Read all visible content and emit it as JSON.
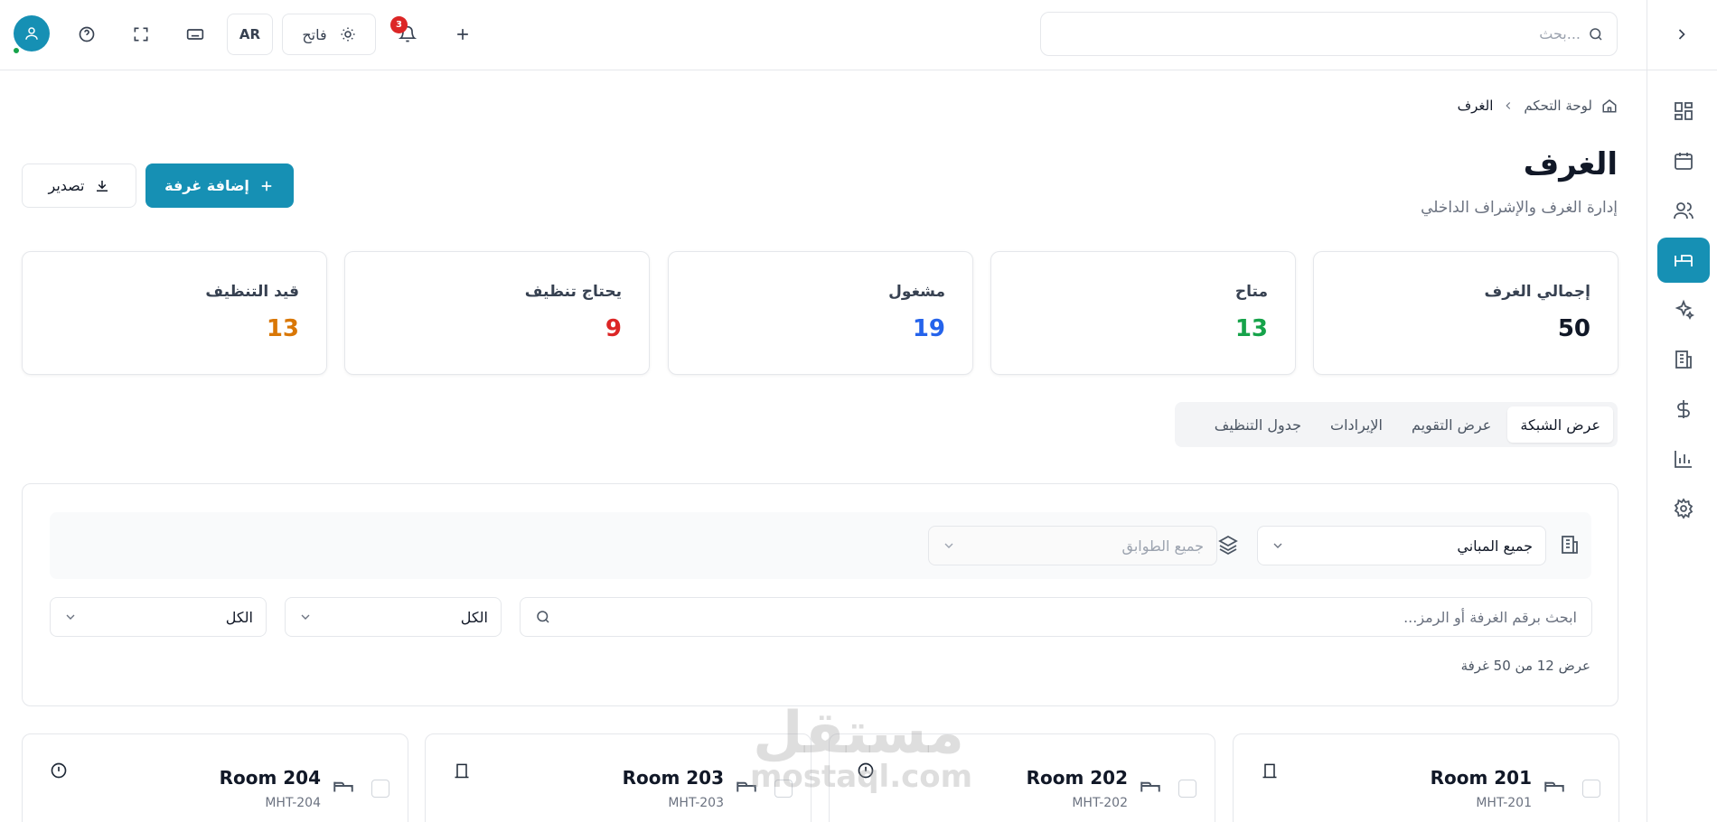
{
  "topbar": {
    "search_placeholder": "بحث...",
    "language": "AR",
    "theme_label": "فاتح",
    "notification_count": "3"
  },
  "breadcrumb": {
    "home": "لوحة التحكم",
    "current": "الغرف"
  },
  "page": {
    "title": "الغرف",
    "subtitle": "إدارة الغرف والإشراف الداخلي",
    "add_button": "إضافة غرفة",
    "export_button": "تصدير"
  },
  "stats": [
    {
      "label": "إجمالي الغرف",
      "value": "50",
      "color": "#111827"
    },
    {
      "label": "متاح",
      "value": "13",
      "color": "#16a34a"
    },
    {
      "label": "مشغول",
      "value": "19",
      "color": "#2563eb"
    },
    {
      "label": "يحتاج تنظيف",
      "value": "9",
      "color": "#dc2626"
    },
    {
      "label": "قيد التنظيف",
      "value": "13",
      "color": "#d97706"
    }
  ],
  "tabs": [
    "عرض الشبكة",
    "عرض التقويم",
    "الإيرادات",
    "جدول التنظيف"
  ],
  "filters": {
    "building": "جميع المباني",
    "floor": "جميع الطوابق",
    "room_search_placeholder": "ابحث برقم الغرفة أو الرمز...",
    "status_select": "الكل",
    "type_select": "الكل",
    "result_count": "عرض 12 من 50 غرفة"
  },
  "rooms": [
    {
      "name": "Room 201",
      "code": "MHT-201",
      "status_icon": "door-icon"
    },
    {
      "name": "Room 202",
      "code": "MHT-202",
      "status_icon": "alert-icon"
    },
    {
      "name": "Room 203",
      "code": "MHT-203",
      "status_icon": "door-icon"
    },
    {
      "name": "Room 204",
      "code": "MHT-204",
      "status_icon": "alert-icon"
    }
  ],
  "watermark": {
    "ar": "مستقل",
    "en": "mostaql.com"
  }
}
